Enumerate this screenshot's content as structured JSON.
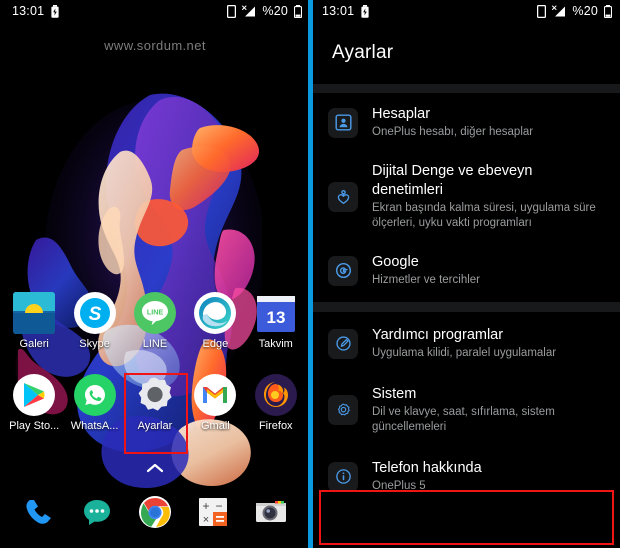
{
  "statusbar": {
    "time": "13:01",
    "battery_left_icon": "battery-charging-icon",
    "sim_icon": "sim-card-icon",
    "signal_icon": "signal-no-service-icon",
    "battery_percent": "%20",
    "battery_icon": "battery-low-icon"
  },
  "left_phone": {
    "watermark": "www.sordum.net",
    "drawer_hint_icon": "chevron-up-icon",
    "apps_row1": [
      {
        "label": "Galeri",
        "icon": "gallery-icon"
      },
      {
        "label": "Skype",
        "icon": "skype-icon"
      },
      {
        "label": "LINE",
        "icon": "line-icon"
      },
      {
        "label": "Edge",
        "icon": "edge-icon"
      },
      {
        "label": "Takvim",
        "icon": "calendar-icon",
        "badge": "13"
      }
    ],
    "apps_row2": [
      {
        "label": "Play Sto...",
        "icon": "play-store-icon"
      },
      {
        "label": "WhatsA...",
        "icon": "whatsapp-icon"
      },
      {
        "label": "Ayarlar",
        "icon": "settings-gear-icon",
        "highlighted": true
      },
      {
        "label": "Gmail",
        "icon": "gmail-icon"
      },
      {
        "label": "Firefox",
        "icon": "firefox-icon"
      }
    ],
    "dock": [
      {
        "label": "Telefon",
        "icon": "phone-icon"
      },
      {
        "label": "Mesajlar",
        "icon": "messages-icon"
      },
      {
        "label": "Chrome",
        "icon": "chrome-icon"
      },
      {
        "label": "Hesap Makinesi",
        "icon": "calculator-icon"
      },
      {
        "label": "Kamera",
        "icon": "camera-icon"
      }
    ]
  },
  "right_phone": {
    "header_title": "Ayarlar",
    "items": [
      {
        "title": "Hesaplar",
        "subtitle": "OnePlus hesabı, diğer hesaplar",
        "icon": "account-box-icon"
      },
      {
        "title": "Dijital Denge ve ebeveyn denetimleri",
        "subtitle": "Ekran başında kalma süresi, uygulama süre ölçerleri, uyku vakti programları",
        "icon": "digital-wellbeing-icon"
      },
      {
        "title": "Google",
        "subtitle": "Hizmetler ve tercihler",
        "icon": "google-g-icon"
      },
      {
        "title": "Yardımcı programlar",
        "subtitle": "Uygulama kilidi, paralel uygulamalar",
        "icon": "utilities-icon"
      },
      {
        "title": "Sistem",
        "subtitle": "Dil ve klavye, saat, sıfırlama, sistem güncellemeleri",
        "icon": "system-gear-icon"
      },
      {
        "title": "Telefon hakkında",
        "subtitle": "OnePlus 5",
        "icon": "info-circle-icon",
        "highlighted": true
      }
    ]
  },
  "colors": {
    "accent_blue": "#0b9ae0",
    "icon_blue": "#4a9ae8",
    "highlight_red": "#f01414",
    "background": "#000000",
    "divider_gray": "#17191a",
    "subtitle_gray": "#9a9c9e"
  }
}
